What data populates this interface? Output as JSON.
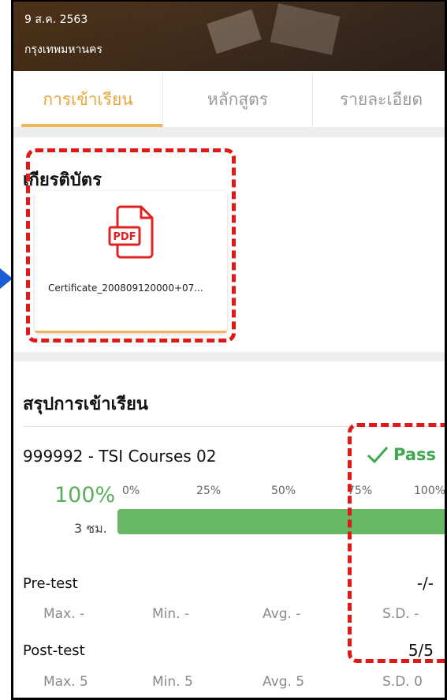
{
  "header": {
    "date": "9 ส.ค. 2563",
    "location": "กรุงเทพมหานคร"
  },
  "tabs": [
    {
      "label": "การเข้าเรียน",
      "active": true
    },
    {
      "label": "หลักสูตร",
      "active": false
    },
    {
      "label": "รายละเอียด",
      "active": false
    }
  ],
  "certificate": {
    "section_title": "เกียรติบัตร",
    "file_name": "Certificate_200809120000+07...",
    "file_icon": "pdf-icon"
  },
  "summary": {
    "section_title": "สรุปการเข้าเรียน",
    "course_name": "999992 - TSI Courses 02",
    "status": "Pass",
    "progress_label": "100%",
    "progress_value": 1.0,
    "hours": "3 ชม.",
    "ticks": [
      "0%",
      "25%",
      "50%",
      "75%",
      "100%"
    ],
    "pre_test": {
      "label": "Pre-test",
      "score": "-/-",
      "max": "Max. -",
      "min": "Min. -",
      "avg": "Avg. -",
      "sd": "S.D. -"
    },
    "post_test": {
      "label": "Post-test",
      "score": "5/5",
      "max": "Max. 5",
      "min": "Min. 5",
      "avg": "Avg. 5",
      "sd": "S.D. 0"
    }
  },
  "colors": {
    "accent": "#f0b75a",
    "tab_active": "#e7a43a",
    "pass_green": "#3fa64f",
    "progress_green": "#66b865",
    "highlight_red": "#e01818",
    "arrow_blue": "#1b5bd6"
  }
}
